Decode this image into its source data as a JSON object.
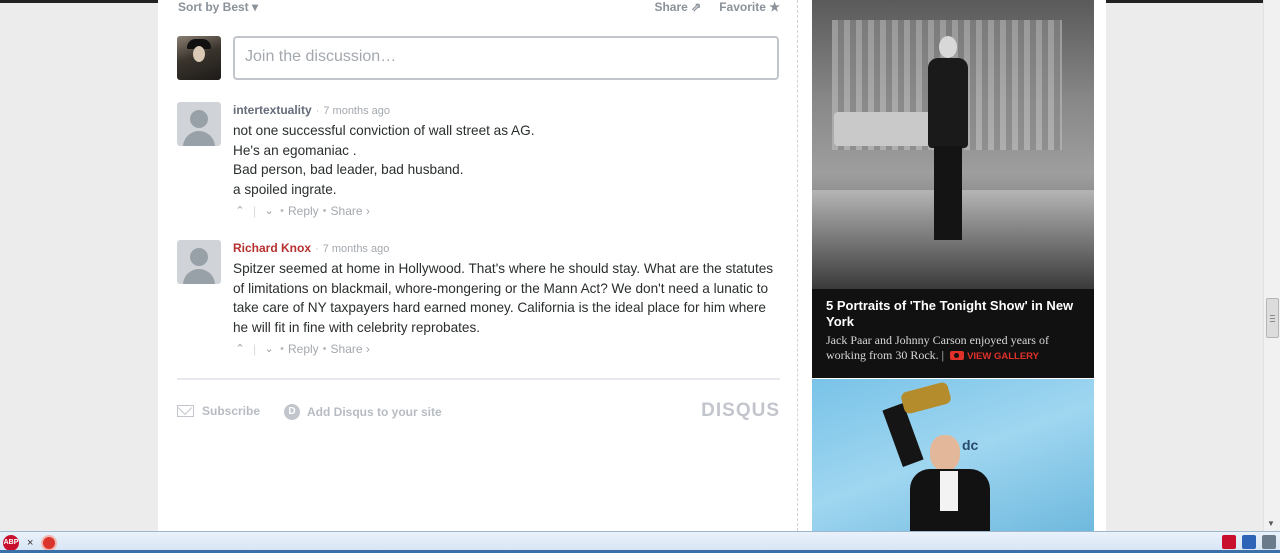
{
  "disqus": {
    "sort_label": "Sort by Best ▾",
    "share_label": "Share",
    "favorite_label": "Favorite ★",
    "input_placeholder": "Join the discussion…",
    "comments": [
      {
        "author": "intertextuality",
        "time": "7 months ago",
        "lines": [
          "not one successful conviction of wall street as AG.",
          "He's an egomaniac .",
          "Bad person, bad leader, bad husband.",
          "a spoiled ingrate."
        ],
        "reply": "Reply",
        "share": "Share ›"
      },
      {
        "author": "Richard Knox",
        "time": "7 months ago",
        "text": "Spitzer seemed at home in Hollywood. That's where he should stay. What are the statutes of limitations on blackmail, whore-mongering or the Mann Act? We don't need a lunatic to take care of NY taxpayers hard earned money. California is the ideal place for him where he will fit in fine with celebrity reprobates.",
        "reply": "Reply",
        "share": "Share ›"
      }
    ],
    "footer": {
      "subscribe": "Subscribe",
      "add_disqus": "Add Disqus to your site",
      "logo": "DISQUS"
    }
  },
  "gallery": {
    "title": "5 Portraits of 'The Tonight Show' in New York",
    "text": "Jack Paar and Johnny Carson enjoyed years of working from 30 Rock.",
    "link": "VIEW GALLERY"
  },
  "statusbar": {
    "abp_label": "ABP"
  },
  "colors": {
    "accent_red": "#b6302f",
    "gallery_link": "#e0302a"
  }
}
